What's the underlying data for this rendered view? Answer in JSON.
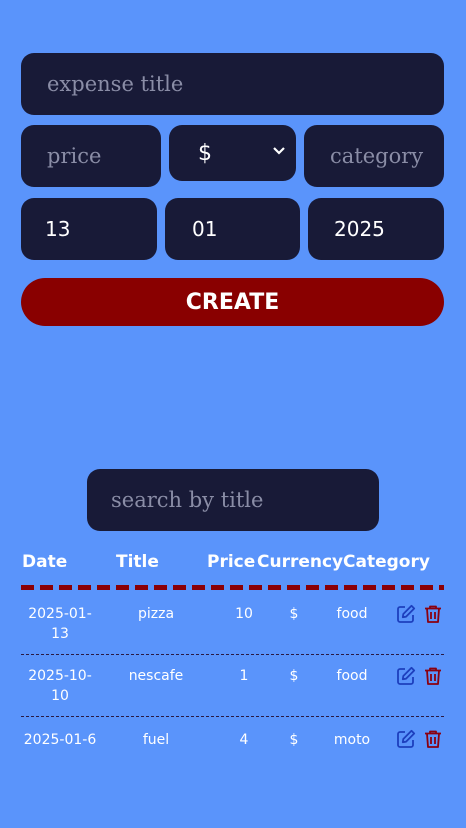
{
  "form": {
    "title_placeholder": "expense title",
    "price_placeholder": "price",
    "currency_value": "$",
    "category_placeholder": "category",
    "day_value": "13",
    "month_value": "01",
    "year_value": "2025",
    "create_label": "CREATE"
  },
  "search": {
    "placeholder": "search by title"
  },
  "table": {
    "headers": {
      "date": "Date",
      "title": "Title",
      "price": "Price",
      "currency": "Currency",
      "category": "Category"
    },
    "rows": [
      {
        "date_line1": "2025-01-",
        "date_line2": "13",
        "title": "pizza",
        "price": "10",
        "currency": "$",
        "category": "food"
      },
      {
        "date_line1": "2025-10-",
        "date_line2": "10",
        "title": "nescafe",
        "price": "1",
        "currency": "$",
        "category": "food"
      },
      {
        "date_line1": "2025-01-6",
        "date_line2": "",
        "title": "fuel",
        "price": "4",
        "currency": "$",
        "category": "moto"
      }
    ]
  },
  "colors": {
    "background": "#5a94fb",
    "field": "#181a37",
    "button": "#890000",
    "divider": "#8a0007",
    "edit_icon": "#1d3fbd",
    "trash_icon": "#8a0010"
  },
  "icons": {
    "edit": "edit-icon",
    "trash": "trash-icon",
    "select": "chevron-down-icon"
  }
}
